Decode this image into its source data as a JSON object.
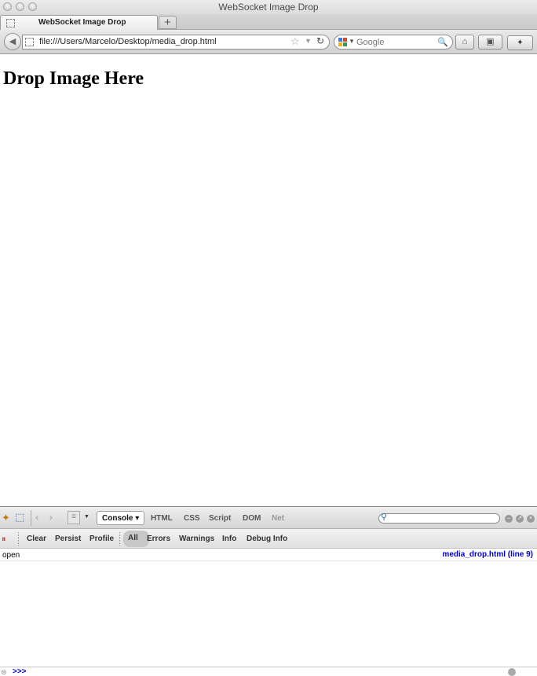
{
  "window": {
    "title": "WebSocket Image Drop"
  },
  "tab": {
    "label": "WebSocket Image Drop",
    "new_tab_icon": "+"
  },
  "nav": {
    "back_icon": "◀",
    "url": "file:///Users/Marcelo/Desktop/media_drop.html",
    "star_icon": "☆",
    "dropdown_icon": "▼",
    "reload_icon": "↻",
    "search_placeholder": "Google",
    "search_icon": "🔍",
    "home_icon": "⌂",
    "bookmark_icon": "▣",
    "firebug_icon": "✦"
  },
  "page": {
    "heading": "Drop Image Here"
  },
  "firebug": {
    "panels": [
      {
        "label": "Console ▾",
        "active": true
      },
      {
        "label": "HTML"
      },
      {
        "label": "CSS"
      },
      {
        "label": "Script"
      },
      {
        "label": "DOM"
      },
      {
        "label": "Net",
        "dim": true
      }
    ],
    "console_buttons": [
      "Clear",
      "Persist",
      "Profile"
    ],
    "filters": [
      {
        "label": "All",
        "active": true
      },
      {
        "label": "Errors"
      },
      {
        "label": "Warnings"
      },
      {
        "label": "Info"
      },
      {
        "label": "Debug Info"
      }
    ],
    "rows": [
      {
        "message": "open",
        "source": "media_drop.html (line 9)"
      }
    ],
    "prompt": ">>>"
  }
}
